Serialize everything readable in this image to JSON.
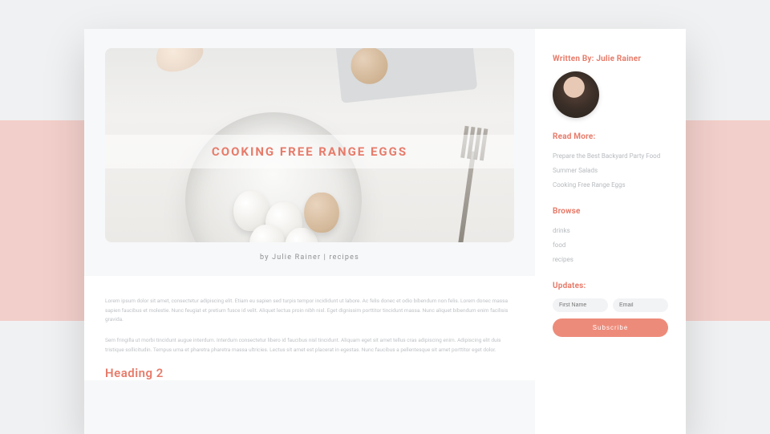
{
  "hero": {
    "title": "COOKING FREE RANGE EGGS"
  },
  "byline": "by Julie Rainer | recipes",
  "article": {
    "p1": "Lorem ipsum dolor sit amet, consectetur adipiscing elit. Etiam eu sapien sed turpis tempor incididunt ut labore. Ac felis donec et odio bibendum non felis. Lorem donec massa sapien faucibus et molestie. Nunc feugiat et pretium fusce id velit. Aliquet lectus proin nibh nisl. Eget dignissim porttitor tincidunt massa. Nunc aliquet bibendum enim facilisis gravida.",
    "p2": "Sem fringilla ut morbi tincidunt augue interdum. Interdum consectetur libero id faucibus nisl tincidunt. Aliquam eget sit amet tellus cras adipiscing enim. Adipiscing elit duis tristique sollicitudin. Tempus urna et pharetra pharetra massa ultricies. Lectus sit amet est placerat in egestas. Nunc faucibus a pellentesque sit amet porttitor eget dolor.",
    "h2": "Heading 2"
  },
  "sidebar": {
    "written_by_label": "Written By:",
    "author": "Julie Rainer",
    "read_more_label": "Read More:",
    "read_more": [
      "Prepare the Best Backyard Party Food",
      "Summer Salads",
      "Cooking Free Range Eggs"
    ],
    "browse_label": "Browse",
    "browse": [
      "drinks",
      "food",
      "recipes"
    ],
    "updates_label": "Updates:",
    "first_name_placeholder": "First Name",
    "email_placeholder": "Email",
    "subscribe_label": "Subscribe"
  }
}
